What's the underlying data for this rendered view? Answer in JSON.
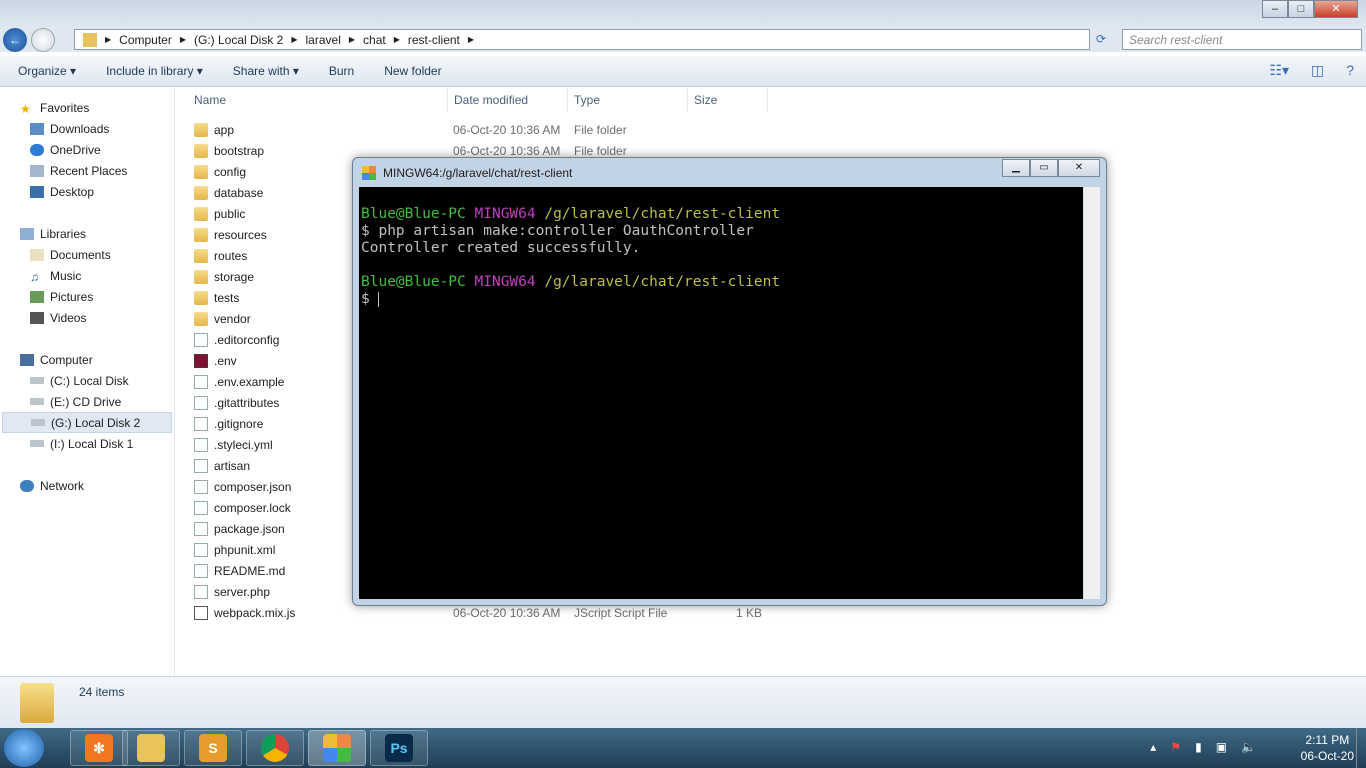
{
  "address": {
    "crumbs": [
      "Computer",
      "(G:) Local Disk 2",
      "laravel",
      "chat",
      "rest-client"
    ],
    "search_placeholder": "Search rest-client"
  },
  "toolbar": {
    "organize": "Organize ▾",
    "include": "Include in library ▾",
    "share": "Share with ▾",
    "burn": "Burn",
    "new_folder": "New folder"
  },
  "sidebar": {
    "favorites": "Favorites",
    "fav_items": [
      "Downloads",
      "OneDrive",
      "Recent Places",
      "Desktop"
    ],
    "libraries": "Libraries",
    "lib_items": [
      "Documents",
      "Music",
      "Pictures",
      "Videos"
    ],
    "computer": "Computer",
    "drives": [
      "(C:) Local Disk",
      "(E:) CD Drive",
      "(G:) Local Disk 2",
      "(I:) Local Disk 1"
    ],
    "network": "Network"
  },
  "columns": {
    "name": "Name",
    "date": "Date modified",
    "type": "Type",
    "size": "Size"
  },
  "files": [
    {
      "name": "app",
      "kind": "dir",
      "date": "06-Oct-20 10:36 AM",
      "type": "File folder",
      "size": ""
    },
    {
      "name": "bootstrap",
      "kind": "dir",
      "date": "06-Oct-20 10:36 AM",
      "type": "File folder",
      "size": ""
    },
    {
      "name": "config",
      "kind": "dir",
      "date": "",
      "type": "",
      "size": ""
    },
    {
      "name": "database",
      "kind": "dir",
      "date": "",
      "type": "",
      "size": ""
    },
    {
      "name": "public",
      "kind": "dir",
      "date": "",
      "type": "",
      "size": ""
    },
    {
      "name": "resources",
      "kind": "dir",
      "date": "",
      "type": "",
      "size": ""
    },
    {
      "name": "routes",
      "kind": "dir",
      "date": "",
      "type": "",
      "size": ""
    },
    {
      "name": "storage",
      "kind": "dir",
      "date": "",
      "type": "",
      "size": ""
    },
    {
      "name": "tests",
      "kind": "dir",
      "date": "",
      "type": "",
      "size": ""
    },
    {
      "name": "vendor",
      "kind": "dir",
      "date": "",
      "type": "",
      "size": ""
    },
    {
      "name": ".editorconfig",
      "kind": "file",
      "date": "",
      "type": "",
      "size": ""
    },
    {
      "name": ".env",
      "kind": "env",
      "date": "",
      "type": "",
      "size": ""
    },
    {
      "name": ".env.example",
      "kind": "file",
      "date": "",
      "type": "",
      "size": ""
    },
    {
      "name": ".gitattributes",
      "kind": "file",
      "date": "",
      "type": "",
      "size": ""
    },
    {
      "name": ".gitignore",
      "kind": "file",
      "date": "",
      "type": "",
      "size": ""
    },
    {
      "name": ".styleci.yml",
      "kind": "file",
      "date": "",
      "type": "",
      "size": ""
    },
    {
      "name": "artisan",
      "kind": "file",
      "date": "",
      "type": "",
      "size": ""
    },
    {
      "name": "composer.json",
      "kind": "file",
      "date": "",
      "type": "",
      "size": ""
    },
    {
      "name": "composer.lock",
      "kind": "file",
      "date": "",
      "type": "",
      "size": ""
    },
    {
      "name": "package.json",
      "kind": "file",
      "date": "",
      "type": "",
      "size": ""
    },
    {
      "name": "phpunit.xml",
      "kind": "file",
      "date": "",
      "type": "",
      "size": ""
    },
    {
      "name": "README.md",
      "kind": "file",
      "date": "",
      "type": "",
      "size": ""
    },
    {
      "name": "server.php",
      "kind": "file",
      "date": "",
      "type": "",
      "size": ""
    },
    {
      "name": "webpack.mix.js",
      "kind": "js",
      "date": "06-Oct-20 10:36 AM",
      "type": "JScript Script File",
      "size": "1 KB"
    }
  ],
  "status": {
    "count": "24 items"
  },
  "terminal": {
    "title": "MINGW64:/g/laravel/chat/rest-client",
    "user": "Blue@Blue-PC",
    "env": "MINGW64",
    "path": "/g/laravel/chat/rest-client",
    "command": "$ php artisan make:controller OauthController",
    "output": "Controller created successfully.",
    "prompt": "$ "
  },
  "taskbar": {
    "apps": [
      "XAMPP",
      "Windows Explorer",
      "Sublime Text",
      "Google Chrome",
      "Git Bash",
      "Photoshop"
    ],
    "time": "2:11 PM",
    "date": "06-Oct-20"
  }
}
